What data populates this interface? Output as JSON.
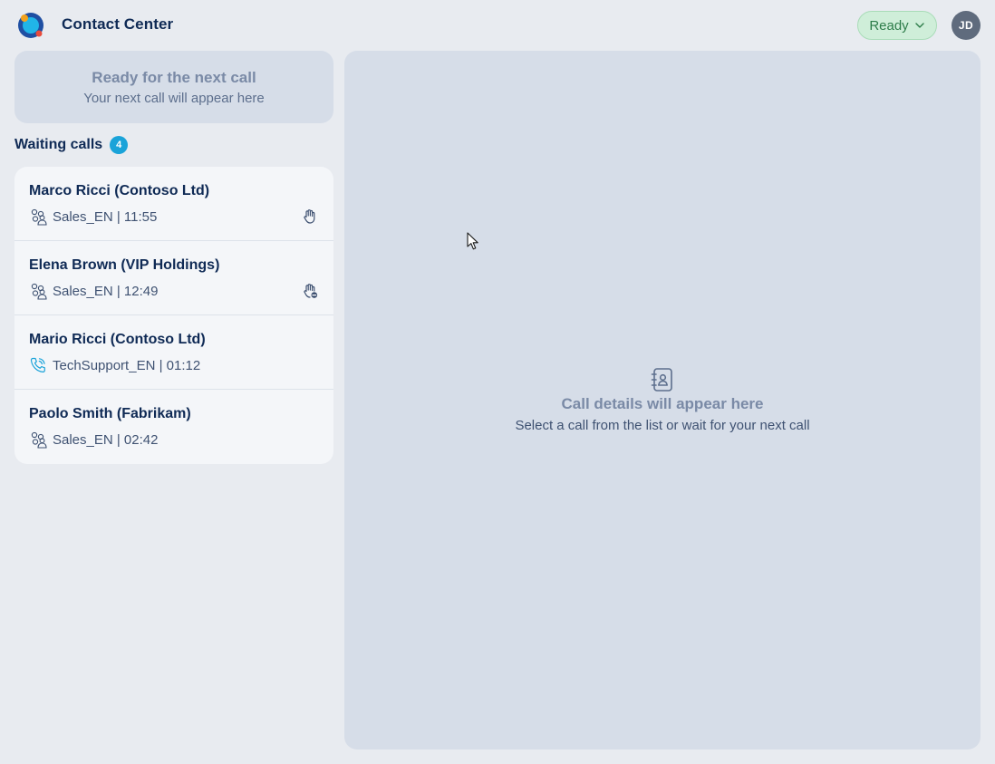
{
  "header": {
    "title": "Contact Center",
    "status": "Ready",
    "avatar_initials": "JD"
  },
  "ready_card": {
    "title": "Ready for the next call",
    "subtitle": "Your next call will appear here"
  },
  "waiting": {
    "title": "Waiting calls",
    "count": "4"
  },
  "calls": [
    {
      "name": "Marco Ricci (Contoso Ltd)",
      "channel_icon": "group-icon",
      "meta": "Sales_EN | 11:55",
      "action_icon": "hand-icon"
    },
    {
      "name": "Elena Brown (VIP Holdings)",
      "channel_icon": "group-icon",
      "meta": "Sales_EN | 12:49",
      "action_icon": "hand-blocked-icon"
    },
    {
      "name": "Mario Ricci (Contoso Ltd)",
      "channel_icon": "phone-icon",
      "meta": "TechSupport_EN | 01:12",
      "action_icon": ""
    },
    {
      "name": "Paolo Smith (Fabrikam)",
      "channel_icon": "group-icon",
      "meta": "Sales_EN | 02:42",
      "action_icon": ""
    }
  ],
  "details": {
    "title": "Call details will appear here",
    "subtitle": "Select a call from the list or wait for your next call"
  },
  "colors": {
    "ready_green_bg": "#cfeed9",
    "ready_green_text": "#2e7d4a",
    "badge_blue": "#1aa3d9",
    "navy": "#0f2a55"
  }
}
